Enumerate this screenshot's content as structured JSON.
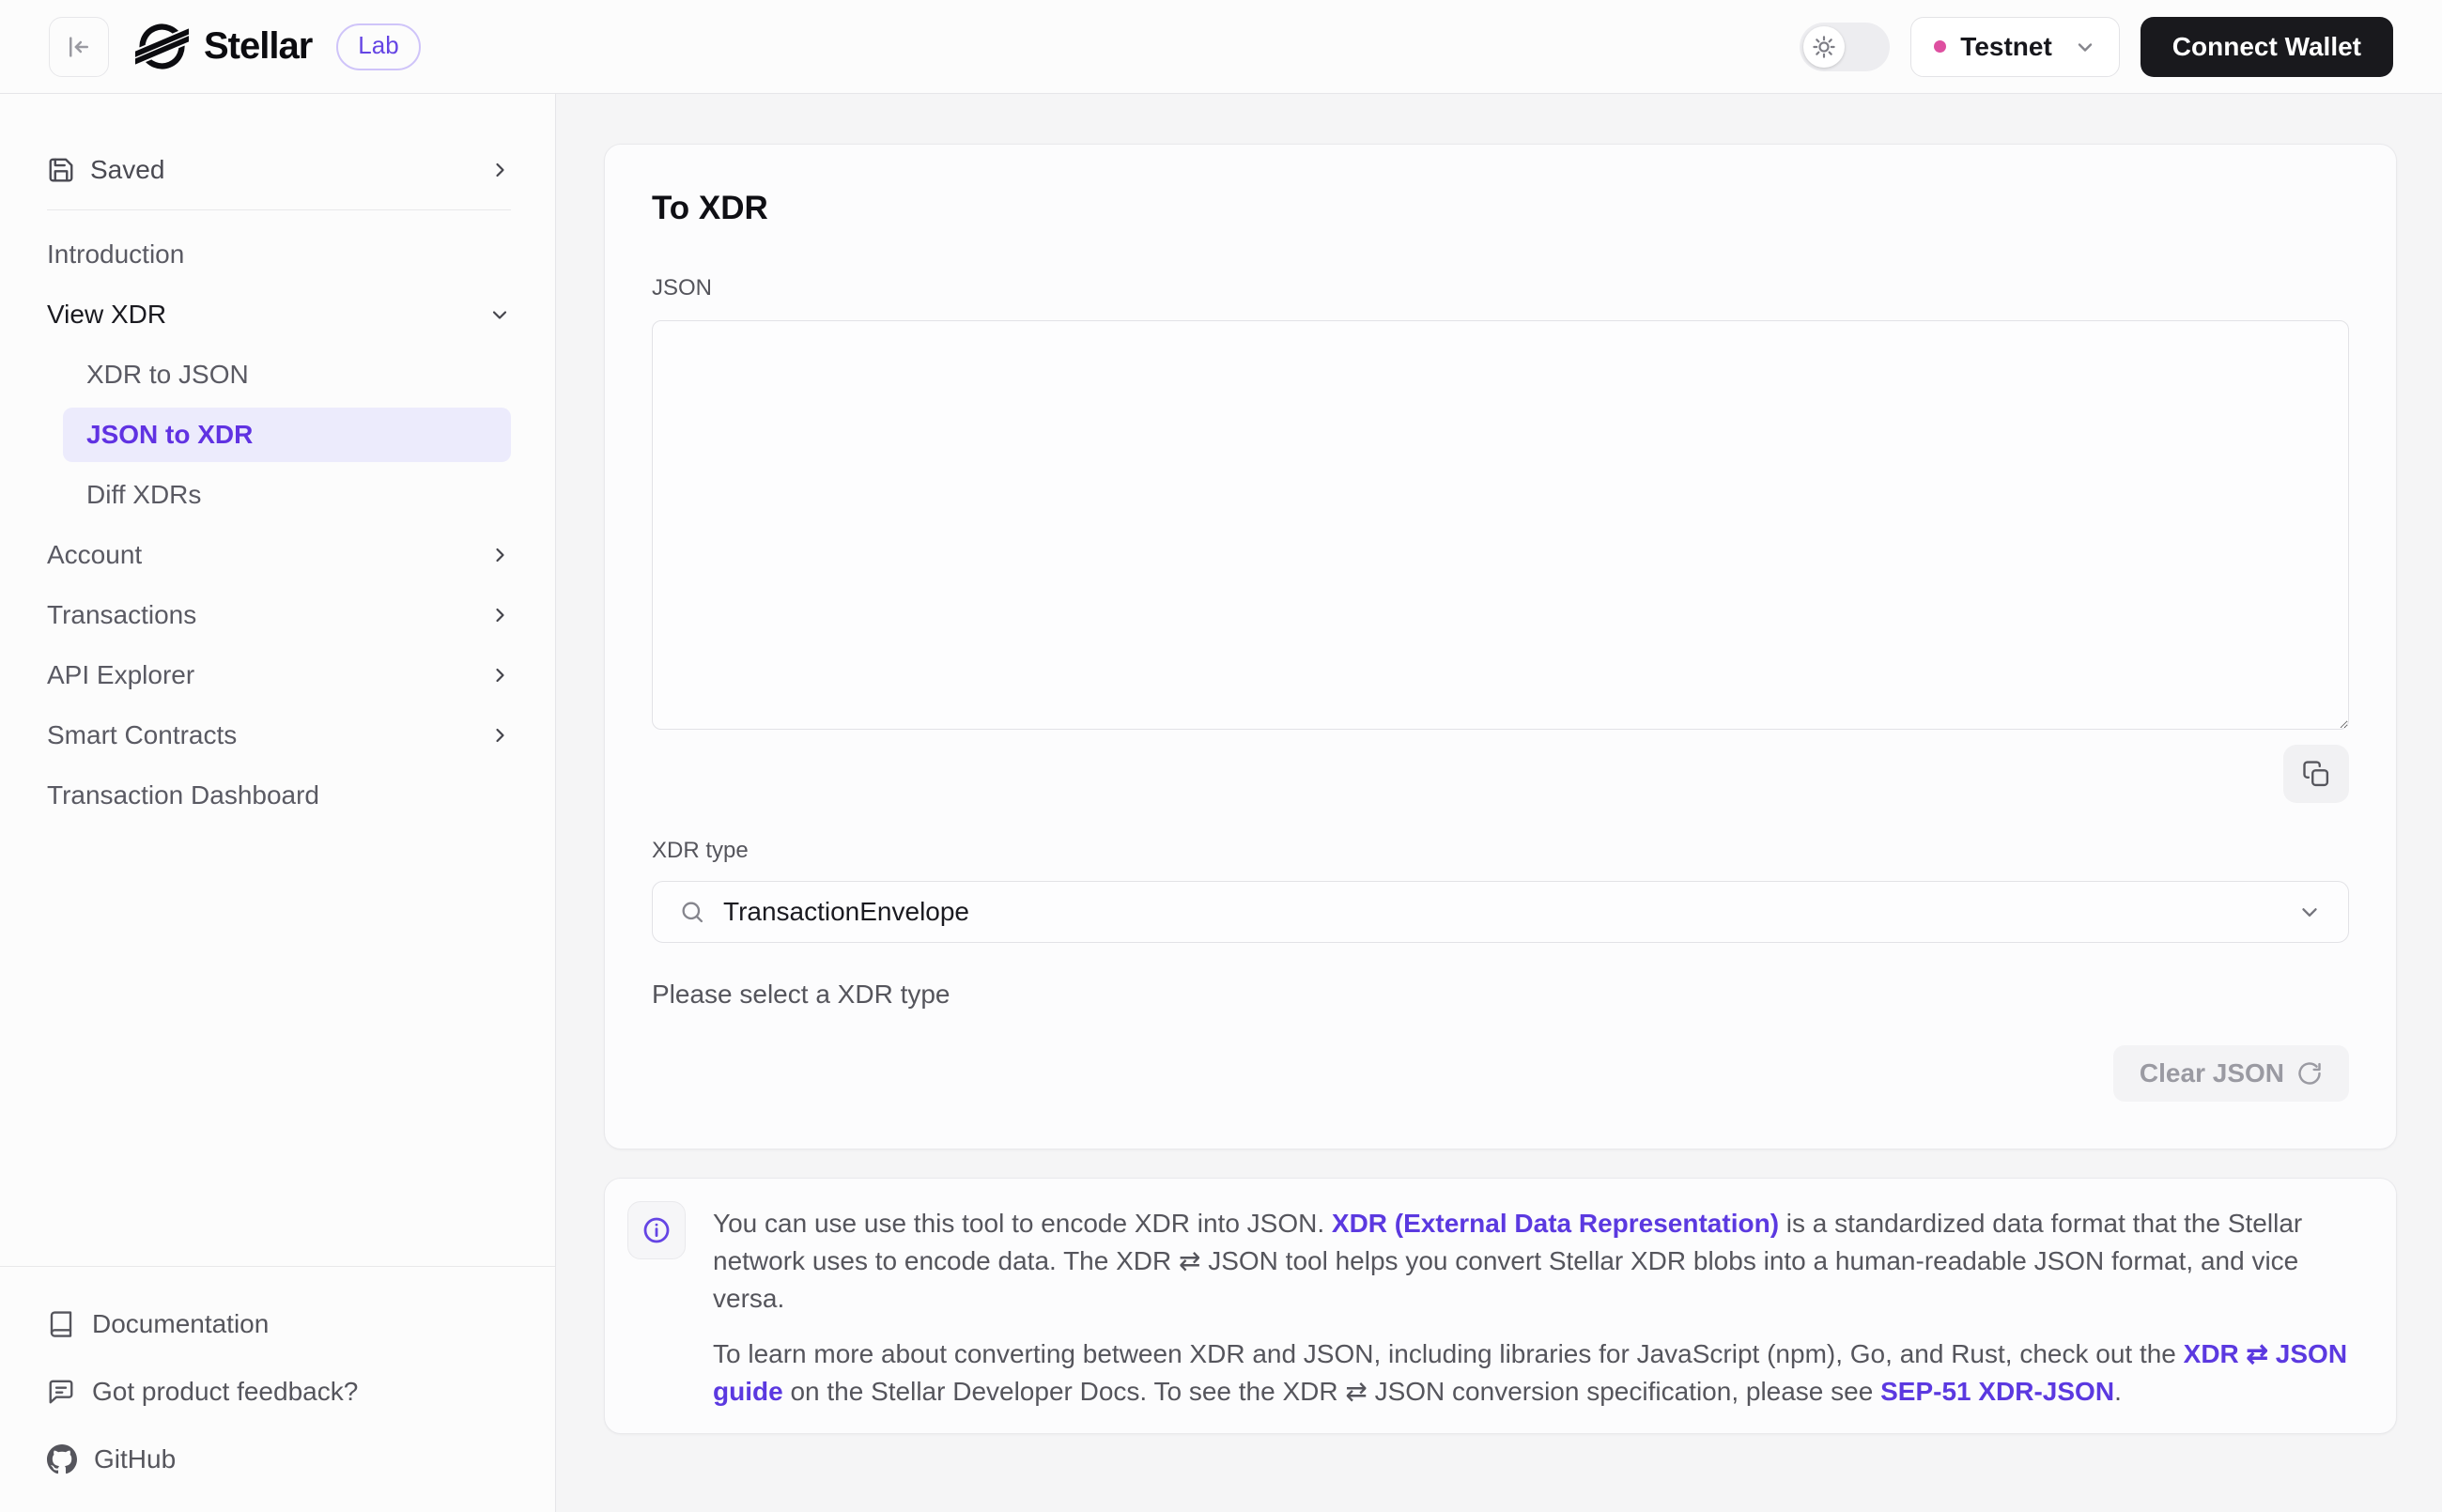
{
  "header": {
    "brand": "Stellar",
    "badge": "Lab",
    "network_label": "Testnet",
    "connect_wallet": "Connect Wallet"
  },
  "sidebar": {
    "saved_label": "Saved",
    "introduction": "Introduction",
    "view_xdr": "View XDR",
    "xdr_to_json": "XDR to JSON",
    "json_to_xdr": "JSON to XDR",
    "diff_xdrs": "Diff XDRs",
    "account": "Account",
    "transactions": "Transactions",
    "api_explorer": "API Explorer",
    "smart_contracts": "Smart Contracts",
    "transaction_dashboard": "Transaction Dashboard",
    "footer": {
      "documentation": "Documentation",
      "feedback": "Got product feedback?",
      "github": "GitHub"
    }
  },
  "main": {
    "title": "To XDR",
    "json_label": "JSON",
    "json_value": "",
    "xdr_type_label": "XDR type",
    "xdr_type_value": "TransactionEnvelope",
    "helper_text": "Please select a XDR type",
    "clear_button": "Clear JSON",
    "info": {
      "paragraph1": [
        {
          "text": "You can use use this tool to encode XDR into JSON. "
        },
        {
          "text": "XDR (External Data Representation)",
          "link": true
        },
        {
          "text": " is a standardized data format that the Stellar network uses to encode data. The XDR ⇄ JSON tool helps you convert Stellar XDR blobs into a human-readable JSON format, and vice versa."
        }
      ],
      "paragraph2": [
        {
          "text": "To learn more about converting between XDR and JSON, including libraries for JavaScript (npm), Go, and Rust, check out the "
        },
        {
          "text": "XDR ⇄ JSON guide",
          "link": true
        },
        {
          "text": " on the Stellar Developer Docs. To see the XDR ⇄ JSON conversion specification, please see "
        },
        {
          "text": "SEP-51 XDR-JSON",
          "link": true
        },
        {
          "text": "."
        }
      ]
    }
  },
  "colors": {
    "accent_purple": "#6545e4",
    "active_item_bg": "#ecebfc",
    "network_dot_pink": "#de4fa0",
    "wallet_button_bg": "#19191d"
  }
}
